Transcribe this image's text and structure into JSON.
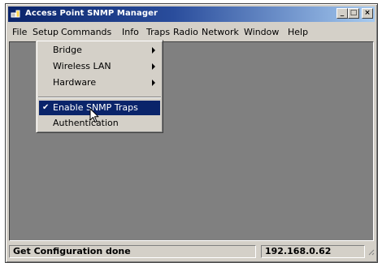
{
  "window": {
    "title": "Access Point SNMP Manager",
    "min_glyph": "_",
    "max_glyph": "□",
    "close_glyph": "×"
  },
  "menubar": {
    "file": "File",
    "setup": "Setup",
    "commands": "Commands",
    "info": "Info",
    "traps": "Traps",
    "radio": "Radio",
    "network": "Network",
    "window": "Window",
    "help": "Help"
  },
  "setup_menu": {
    "bridge": "Bridge",
    "wireless_lan": "Wireless LAN",
    "hardware": "Hardware",
    "enable_snmp_traps": "Enable SNMP Traps",
    "enable_snmp_traps_checked": true,
    "check_glyph": "✔",
    "authentication": "Authentication",
    "highlighted_item": "Enable SNMP Traps"
  },
  "statusbar": {
    "message": "Get Configuration done",
    "ip_address": "192.168.0.62"
  },
  "colors": {
    "title_active": "#0a246a",
    "menu_highlight": "#0a246a",
    "workspace": "#808080",
    "face": "#d4d0c8"
  }
}
